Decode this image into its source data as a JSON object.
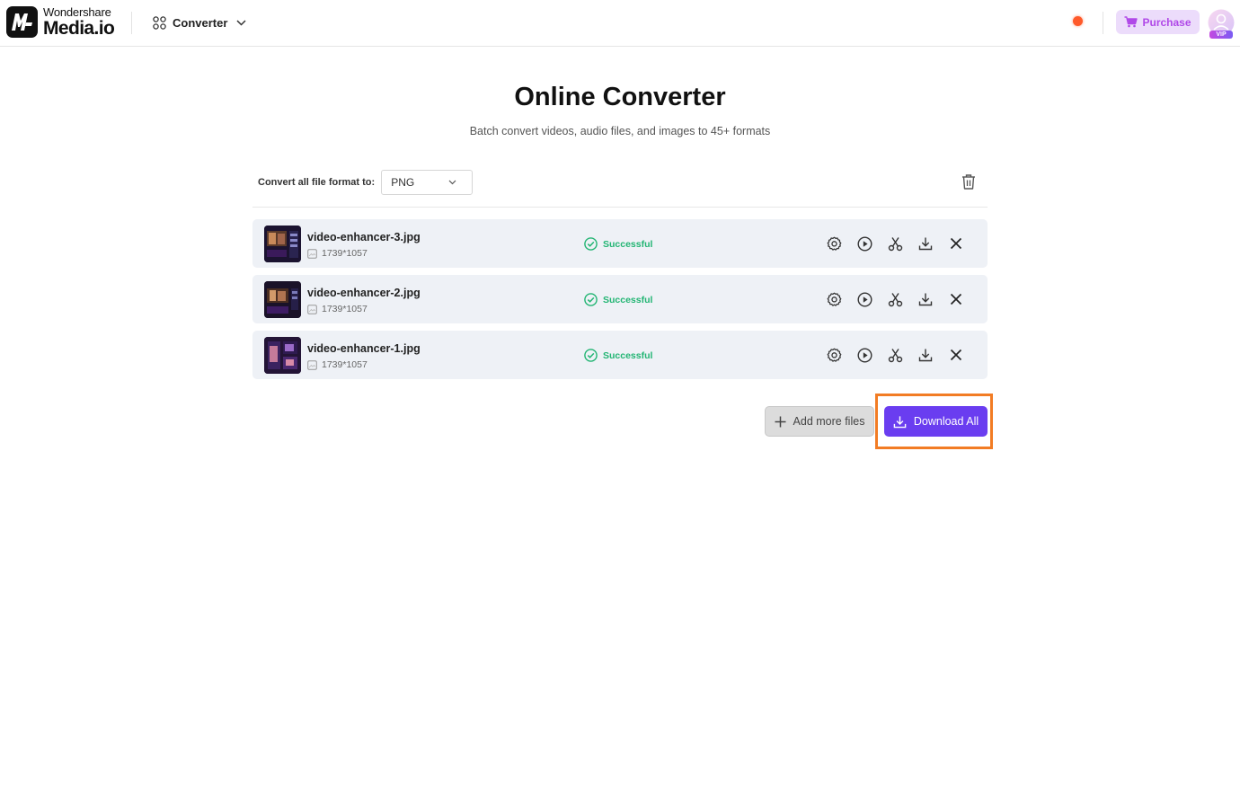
{
  "header": {
    "brand": "Wondershare",
    "product": "Media.io",
    "nav_label": "Converter",
    "purchase_label": "Purchase",
    "avatar_badge": "VIP",
    "notification_color": "#ff5a2a"
  },
  "main": {
    "title": "Online Converter",
    "subtitle": "Batch convert videos, audio files, and images to 45+ formats",
    "format_label": "Convert all file format to:",
    "format_value": "PNG"
  },
  "files": [
    {
      "name": "video-enhancer-3.jpg",
      "dimensions": "1739*1057",
      "status": "Successful"
    },
    {
      "name": "video-enhancer-2.jpg",
      "dimensions": "1739*1057",
      "status": "Successful"
    },
    {
      "name": "video-enhancer-1.jpg",
      "dimensions": "1739*1057",
      "status": "Successful"
    }
  ],
  "row_actions": [
    "settings-icon",
    "play-icon",
    "scissors-icon",
    "download-icon",
    "close-icon"
  ],
  "footer": {
    "add_label": "Add more files",
    "download_all_label": "Download All"
  },
  "colors": {
    "accent": "#6a3df0",
    "success": "#22b573",
    "highlight": "#f27c24",
    "purchase_bg": "#ecdcfb",
    "purchase_text": "#b048e8"
  }
}
